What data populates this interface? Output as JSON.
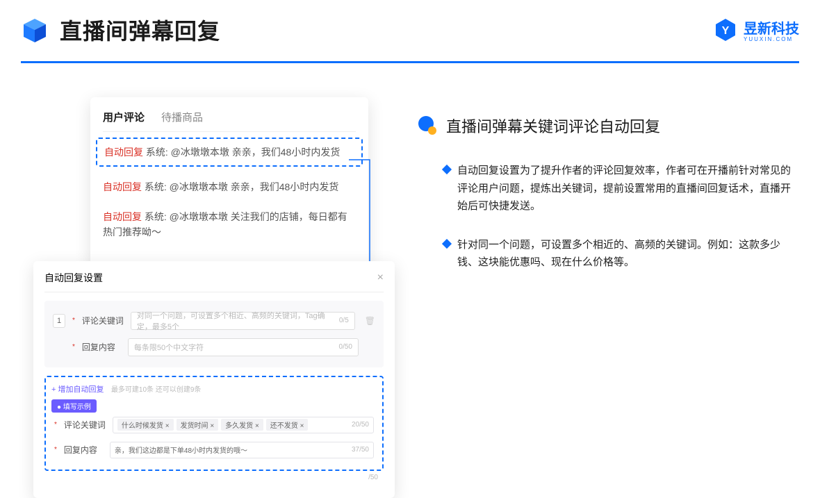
{
  "header": {
    "title": "直播间弹幕回复",
    "brand_name": "昱新科技",
    "brand_sub": "YUUXIN.COM"
  },
  "comment_panel": {
    "tab_active": "用户评论",
    "tab_inactive": "待播商品",
    "badge": "自动回复",
    "row1_text": " 系统: @冰墩墩本墩 亲亲，我们48小时内发货",
    "row2_text": " 系统: @冰墩墩本墩 亲亲，我们48小时内发货",
    "row3_text": " 系统: @冰墩墩本墩 关注我们的店铺，每日都有热门推荐呦～"
  },
  "settings": {
    "title": "自动回复设置",
    "idx": "1",
    "kw_label": "评论关键词",
    "kw_placeholder": "对同一个问题，可设置多个相近、高频的关键词，Tag确定，最多5个",
    "kw_counter": "0/5",
    "content_label": "回复内容",
    "content_placeholder": "每条限50个中文字符",
    "content_counter": "0/50",
    "add_link": "+ 增加自动回复",
    "add_hint": "最多可建10条 还可以创建9条",
    "ex_badge": "● 填写示例",
    "ex_kw_label": "评论关键词",
    "ex_tags": [
      "什么时候发货 ×",
      "发货时间 ×",
      "多久发货 ×",
      "还不发货 ×"
    ],
    "ex_kw_counter": "20/50",
    "ex_content_label": "回复内容",
    "ex_content_text": "亲，我们这边都是下单48小时内发货的哦～",
    "ex_content_counter": "37/50",
    "outer_counter": "/50"
  },
  "right": {
    "sec_title": "直播间弹幕关键词评论自动回复",
    "bullet1": "自动回复设置为了提升作者的评论回复效率，作者可在开播前针对常见的评论用户问题，提炼出关键词，提前设置常用的直播间回复话术，直播开始后可快捷发送。",
    "bullet2": "针对同一个问题，可设置多个相近的、高频的关键词。例如：这款多少钱、这块能优惠吗、现在什么价格等。"
  }
}
